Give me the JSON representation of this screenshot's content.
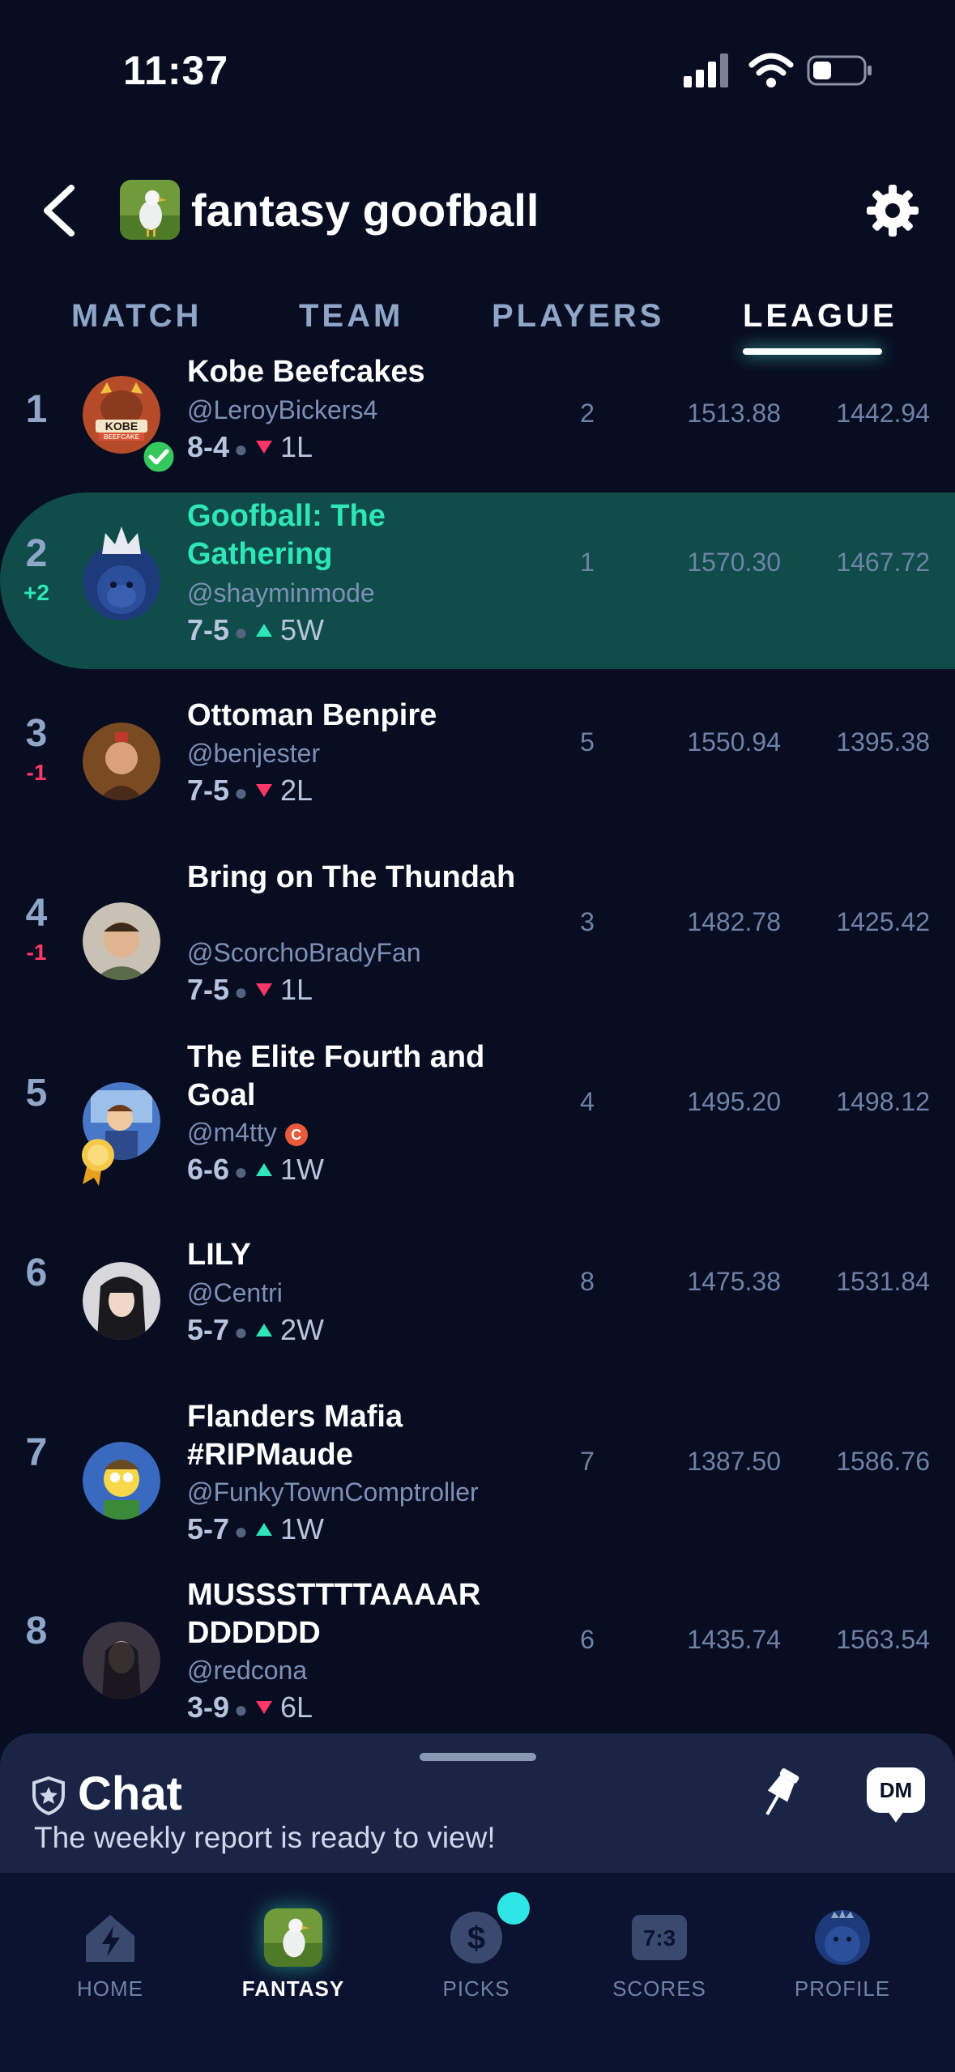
{
  "status_bar": {
    "time": "11:37"
  },
  "header": {
    "league_name": "fantasy goofball"
  },
  "tabs": [
    {
      "label": "MATCH"
    },
    {
      "label": "TEAM"
    },
    {
      "label": "PLAYERS"
    },
    {
      "label": "LEAGUE",
      "active": true
    }
  ],
  "standings": [
    {
      "rank": "1",
      "change": "",
      "name": "Kobe Beefcakes",
      "handle": "@LeroyBickers4",
      "record": "8-4",
      "streak": "1L",
      "streak_dir": "down",
      "c1": "2",
      "c2": "1513.88",
      "c3": "1442.94"
    },
    {
      "rank": "2",
      "change": "+2",
      "name": "Goofball: The Gathering",
      "handle": "@shayminmode",
      "record": "7-5",
      "streak": "5W",
      "streak_dir": "up",
      "c1": "1",
      "c2": "1570.30",
      "c3": "1467.72",
      "highlight": true
    },
    {
      "rank": "3",
      "change": "-1",
      "name": "Ottoman Benpire",
      "handle": "@benjester",
      "record": "7-5",
      "streak": "2L",
      "streak_dir": "down",
      "c1": "5",
      "c2": "1550.94",
      "c3": "1395.38"
    },
    {
      "rank": "4",
      "change": "-1",
      "name": "Bring on The Thundah",
      "handle": "@ScorchoBradyFan",
      "record": "7-5",
      "streak": "1L",
      "streak_dir": "down",
      "c1": "3",
      "c2": "1482.78",
      "c3": "1425.42"
    },
    {
      "rank": "5",
      "change": "",
      "name": "The Elite Fourth and Goal",
      "handle": "@m4tty",
      "record": "6-6",
      "streak": "1W",
      "streak_dir": "up",
      "c1": "4",
      "c2": "1495.20",
      "c3": "1498.12"
    },
    {
      "rank": "6",
      "change": "",
      "name": "LILY",
      "handle": "@Centri",
      "record": "5-7",
      "streak": "2W",
      "streak_dir": "up",
      "c1": "8",
      "c2": "1475.38",
      "c3": "1531.84"
    },
    {
      "rank": "7",
      "change": "",
      "name": "Flanders Mafia #RIPMaude",
      "handle": "@FunkyTownComptroller",
      "record": "5-7",
      "streak": "1W",
      "streak_dir": "up",
      "c1": "7",
      "c2": "1387.50",
      "c3": "1586.76"
    },
    {
      "rank": "8",
      "change": "",
      "name": "MUSSSTTTTAAAAR DDDDDD",
      "handle": "@redcona",
      "record": "3-9",
      "streak": "6L",
      "streak_dir": "down",
      "c1": "6",
      "c2": "1435.74",
      "c3": "1563.54"
    }
  ],
  "badges": {
    "kobe_logo_text": "KOBE",
    "kobe_logo_sub": "BEEFCAKE",
    "m4tty_badge": "C"
  },
  "chat": {
    "title": "Chat",
    "subtitle": "The weekly report is ready to view!",
    "dm_label": "DM"
  },
  "nav": [
    {
      "label": "HOME"
    },
    {
      "label": "FANTASY",
      "active": true
    },
    {
      "label": "PICKS"
    },
    {
      "label": "SCORES"
    },
    {
      "label": "PROFILE"
    }
  ],
  "scores_icon_text": "7:3",
  "picks_icon_text": "$",
  "colors": {
    "accent": "#2ee6b6",
    "down": "#ff3766",
    "background": "#080d22",
    "highlight_row": "#0f4c4a"
  }
}
